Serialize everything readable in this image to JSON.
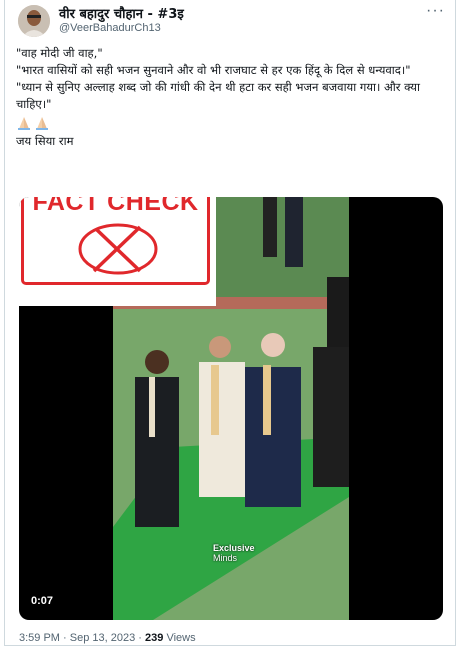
{
  "author": {
    "name": "वीर बहादुर चौहान - #3इ",
    "handle": "@VeerBahadurCh13"
  },
  "tweet": {
    "lines": [
      "\"वाह मोदी जी वाह,\"",
      "\"भारत वासियों को सही भजन सुनवाने और वो भी राजघाट से हर एक हिंदू के दिल से धन्यवाद।\"",
      "\"ध्यान से सुनिए अल्लाह शब्द जो की गांधी की देन थी हटा कर सही भजन बजवाया गया। और क्या चाहिए।\""
    ],
    "emojis": [
      "folded-hands-icon",
      "folded-hands-icon"
    ],
    "closing": "जय सिया राम"
  },
  "media": {
    "overlay_text": "FACT CHECK",
    "duration": "0:07",
    "watermark_line1": "Exclusive",
    "watermark_line2": "Minds",
    "overlay_color": "#e0282c"
  },
  "meta": {
    "time": "3:59 PM",
    "separator": "·",
    "date": "Sep 13, 2023",
    "views_count": "239",
    "views_label": "Views"
  }
}
